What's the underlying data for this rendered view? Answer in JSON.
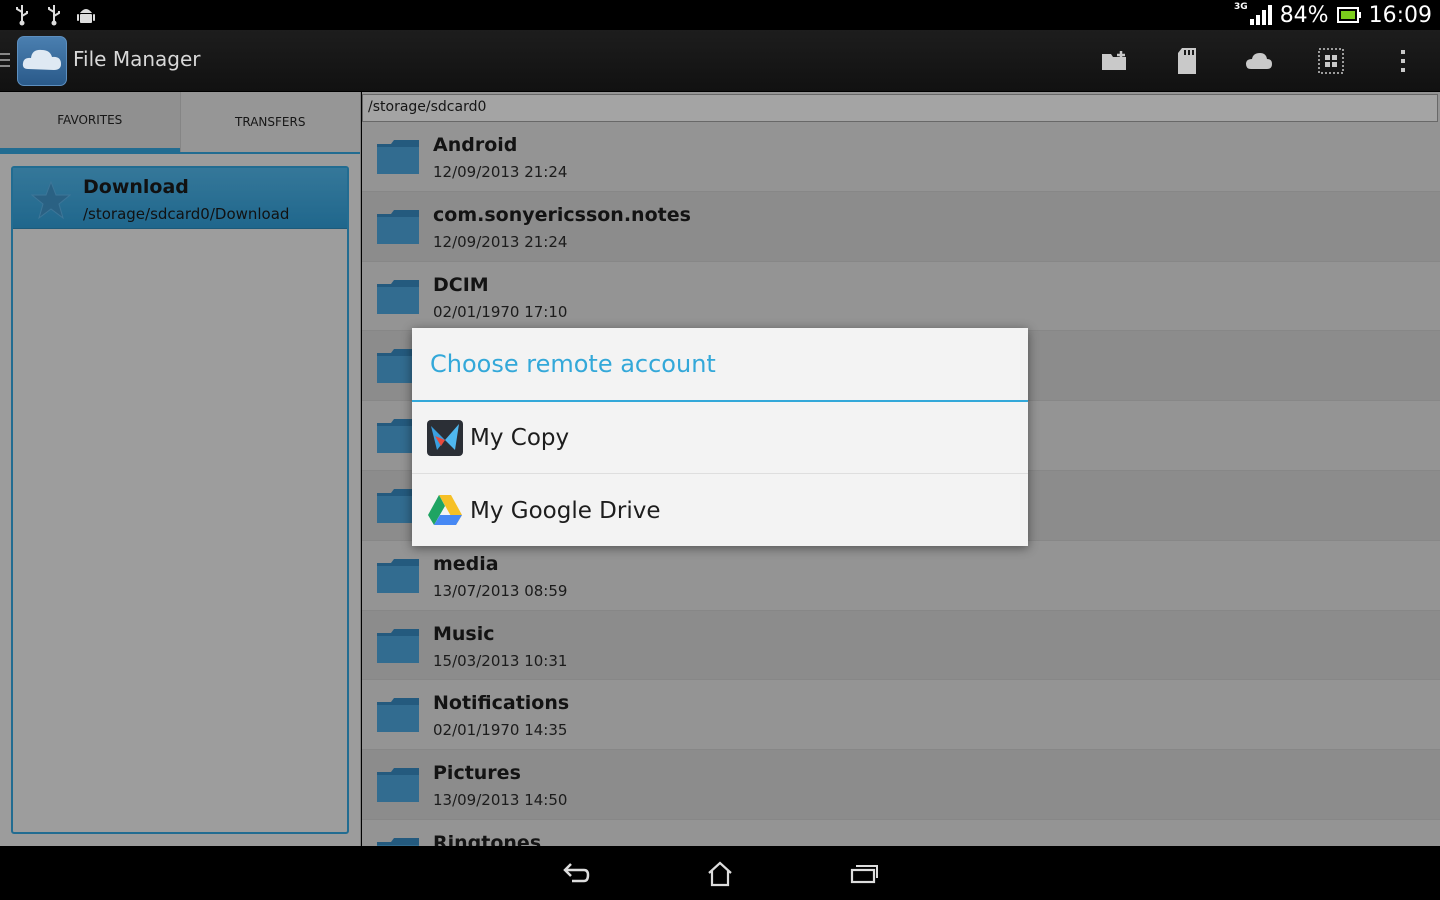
{
  "status_bar": {
    "network": "3G",
    "battery": "84%",
    "time": "16:09",
    "left_icons": [
      "usb-icon",
      "usb-debug-icon",
      "android-icon"
    ]
  },
  "action_bar": {
    "title": "File Manager",
    "actions": [
      "new-folder-icon",
      "sd-card-icon",
      "cloud-icon",
      "select-grid-icon",
      "overflow-menu-icon"
    ]
  },
  "left_pane": {
    "tabs": [
      {
        "label": "FAVORITES",
        "active": true
      },
      {
        "label": "TRANSFERS",
        "active": false
      }
    ],
    "favorites": [
      {
        "name": "Download",
        "path": "/storage/sdcard0/Download"
      }
    ]
  },
  "right_pane": {
    "path": "/storage/sdcard0",
    "files": [
      {
        "name": "Android",
        "date": "12/09/2013 21:24"
      },
      {
        "name": "com.sonyericsson.notes",
        "date": "12/09/2013 21:24"
      },
      {
        "name": "DCIM",
        "date": "02/01/1970 17:10"
      },
      {
        "name": "",
        "date": ""
      },
      {
        "name": "",
        "date": ""
      },
      {
        "name": "",
        "date": ""
      },
      {
        "name": "media",
        "date": "13/07/2013 08:59"
      },
      {
        "name": "Music",
        "date": "15/03/2013 10:31"
      },
      {
        "name": "Notifications",
        "date": "02/01/1970 14:35"
      },
      {
        "name": "Pictures",
        "date": "13/09/2013 14:50"
      },
      {
        "name": "Ringtones",
        "date": ""
      }
    ]
  },
  "dialog": {
    "title": "Choose remote account",
    "items": [
      {
        "label": "My Copy",
        "icon": "copy-app-icon"
      },
      {
        "label": "My Google Drive",
        "icon": "google-drive-icon"
      }
    ]
  },
  "nav_bar": {
    "buttons": [
      "back-icon",
      "home-icon",
      "recent-apps-icon"
    ]
  },
  "colors": {
    "accent": "#33a8d9",
    "highlight": "#3aa3d8"
  }
}
